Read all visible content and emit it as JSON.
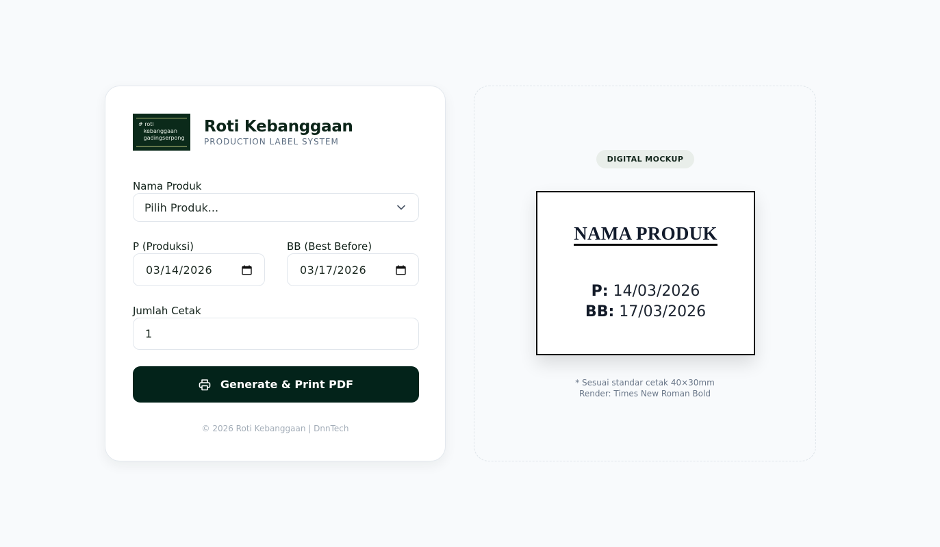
{
  "brand": {
    "logo_text": "# roti\n   kebanggaan\n   gadingserpong",
    "title": "Roti Kebanggaan",
    "subtitle": "PRODUCTION LABEL SYSTEM"
  },
  "form": {
    "product_label": "Nama Produk",
    "product_value": "Pilih Produk...",
    "prod_label": "P (Produksi)",
    "prod_value": "03/14/2026",
    "bb_label": "BB (Best Before)",
    "bb_value": "03/17/2026",
    "qty_label": "Jumlah Cetak",
    "qty_value": "1",
    "button_label": "Generate & Print PDF"
  },
  "footer": "© 2026 Roti Kebanggaan | DnnTech",
  "preview": {
    "badge": "DIGITAL MOCKUP",
    "product_name": "NAMA PRODUK",
    "p_prefix": "P:",
    "p_date": "14/03/2026",
    "bb_prefix": "BB:",
    "bb_date": "17/03/2026",
    "note_line1": "* Sesuai standar cetak 40×30mm",
    "note_line2": "Render: Times New Roman Bold"
  },
  "colors": {
    "primary": "#03231a",
    "background": "#f8fafc"
  }
}
